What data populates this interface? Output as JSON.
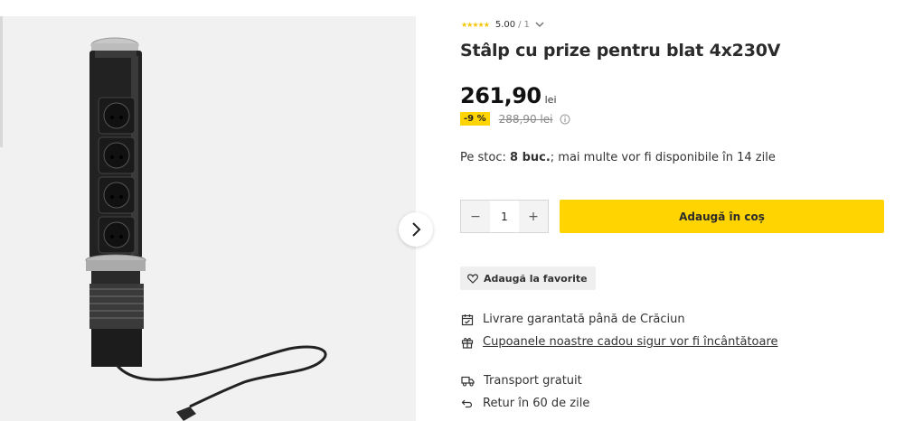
{
  "product": {
    "rating": {
      "stars": "★★★★★",
      "score": "5.00",
      "separator": "/",
      "count": "1"
    },
    "title": "Stâlp cu prize pentru blat 4x230V",
    "price": {
      "amount": "261,90",
      "currency": "lei"
    },
    "discount": {
      "badge": "-9 %",
      "old_price": "288,90 lei"
    },
    "stock": {
      "label": "Pe stoc:",
      "qty": "8 buc.",
      "rest": "; mai multe vor fi disponibile în 14 zile"
    }
  },
  "cart": {
    "quantity": "1",
    "minus": "−",
    "plus": "+",
    "add_label": "Adaugă în coș"
  },
  "favorite": {
    "label": "Adaugă la favorite"
  },
  "features": [
    {
      "icon": "calendar-icon",
      "text": "Livrare garantată până de Crăciun"
    },
    {
      "icon": "gift-icon",
      "text": "Cupoanele noastre cadou sigur vor fi încântătoare"
    },
    {
      "icon": "truck-icon",
      "text": "Transport gratuit"
    },
    {
      "icon": "return-icon",
      "text": "Retur în 60 de zile"
    }
  ],
  "colors": {
    "accent": "#ffd400",
    "image_bg": "#f1f1f1",
    "text": "#2b2b2b"
  }
}
